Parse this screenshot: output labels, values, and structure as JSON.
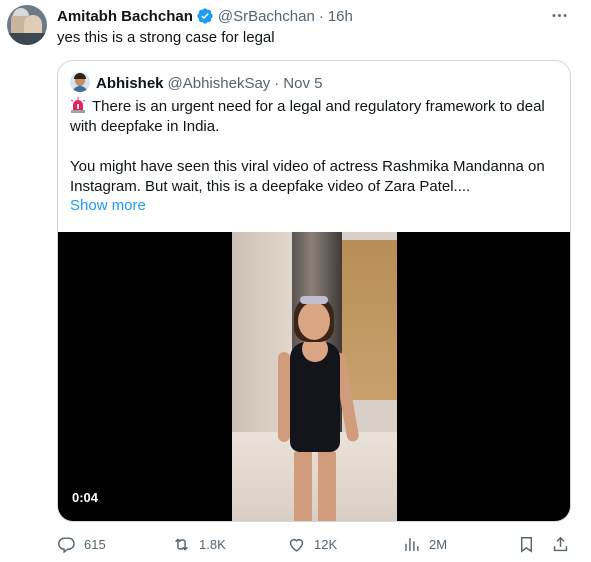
{
  "tweet": {
    "author_name": "Amitabh Bachchan",
    "handle": "@SrBachchan",
    "separator": "·",
    "time": "16h",
    "text": "yes this is a strong case for legal"
  },
  "quote": {
    "author_name": "Abhishek",
    "handle": "@AbhishekSay",
    "separator": "·",
    "date": "Nov 5",
    "line1": "There is an urgent need for a legal and regulatory framework to deal",
    "line2": "with deepfake in India.",
    "line3": "You might have seen this viral video of actress Rashmika Mandanna on",
    "line4": "Instagram. But wait, this is a deepfake video of Zara Patel....",
    "show_more": "Show more",
    "video_duration": "0:04"
  },
  "actions": {
    "replies": "615",
    "retweets": "1.8K",
    "likes": "12K",
    "views": "2M"
  },
  "colors": {
    "verified_badge": "#1d9bf0",
    "link": "#1d9bf0",
    "secondary_text": "#536471",
    "border": "#cfd9de"
  },
  "icons": [
    "verified-icon",
    "more-icon",
    "siren-icon",
    "reply-icon",
    "retweet-icon",
    "like-icon",
    "views-icon",
    "bookmark-icon",
    "share-icon"
  ]
}
